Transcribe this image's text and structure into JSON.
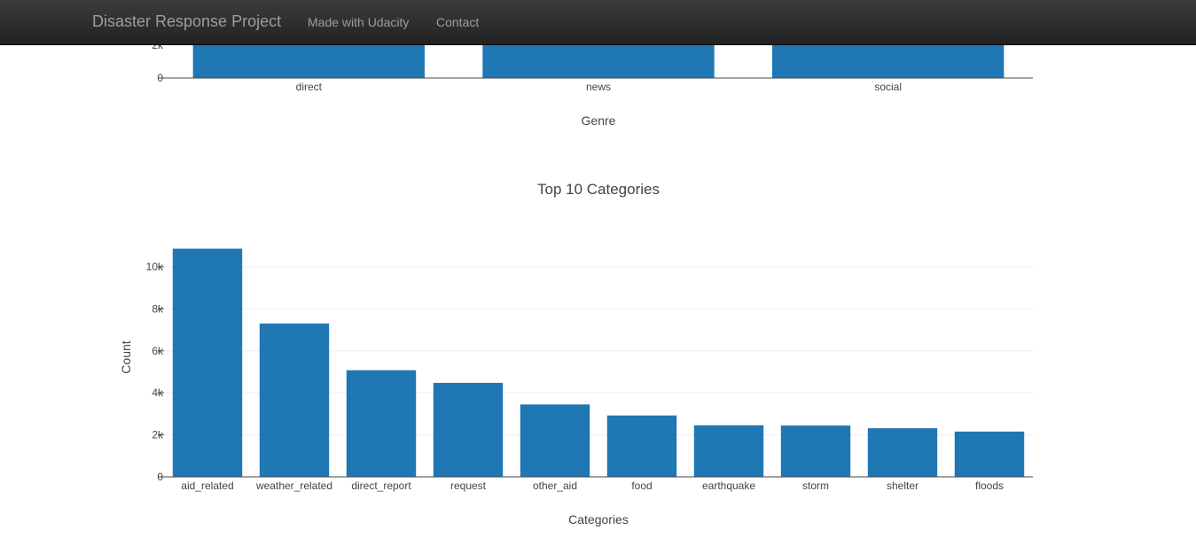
{
  "nav": {
    "brand": "Disaster Response Project",
    "links": [
      "Made with Udacity",
      "Contact"
    ],
    "background": "#222222",
    "text_color": "#9d9d9d"
  },
  "chart_data": [
    {
      "type": "bar",
      "xlabel": "Genre",
      "categories": [
        "direct",
        "news",
        "social"
      ],
      "visible_ytick_labels": [
        "0",
        "2k"
      ],
      "color": "#1f77b4"
    },
    {
      "type": "bar",
      "title": "Top 10 Categories",
      "xlabel": "Categories",
      "ylabel": "Count",
      "categories": [
        "aid_related",
        "weather_related",
        "direct_report",
        "request",
        "other_aid",
        "food",
        "earthquake",
        "storm",
        "shelter",
        "floods"
      ],
      "values": [
        10860,
        7297,
        5075,
        4474,
        3446,
        2923,
        2455,
        2443,
        2314,
        2155
      ],
      "ylim": [
        0,
        11432
      ],
      "yticks": [
        0,
        2000,
        4000,
        6000,
        8000,
        10000
      ],
      "ytick_labels": [
        "0",
        "2k",
        "4k",
        "6k",
        "8k",
        "10k"
      ],
      "grid": true,
      "color": "#1f77b4"
    }
  ]
}
